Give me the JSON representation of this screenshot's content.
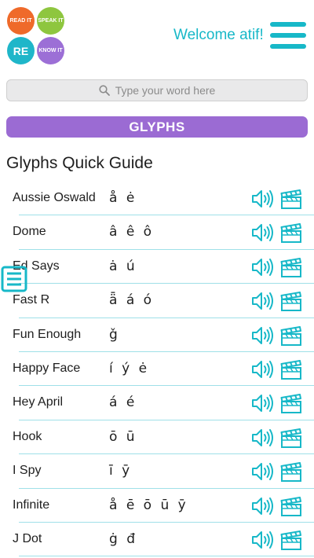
{
  "header": {
    "logo": {
      "read": "READ IT",
      "speak": "SPEAK IT",
      "re": "RE",
      "know": "KNOW IT"
    },
    "welcome": "Welcome atif!"
  },
  "search": {
    "placeholder": "Type your word here"
  },
  "banner": {
    "label": "GLYPHS"
  },
  "section_title": "Glyphs Quick Guide",
  "rows": [
    {
      "name": "Aussie Oswald",
      "glyphs": "å ė"
    },
    {
      "name": "Dome",
      "glyphs": "â ê ô"
    },
    {
      "name": "Ed Says",
      "glyphs": "ȧ ú"
    },
    {
      "name": "Fast R",
      "glyphs": "ǟ á ó"
    },
    {
      "name": "Fun Enough",
      "glyphs": "ǧ"
    },
    {
      "name": "Happy Face",
      "glyphs": "í ý ė"
    },
    {
      "name": "Hey April",
      "glyphs": "á é"
    },
    {
      "name": "Hook",
      "glyphs": "ō ū"
    },
    {
      "name": "I Spy",
      "glyphs": "ī ȳ"
    },
    {
      "name": "Infinite",
      "glyphs": "å ē ō ū ȳ"
    },
    {
      "name": "J Dot",
      "glyphs": "ġ đ"
    }
  ],
  "colors": {
    "teal": "#17b8c8",
    "purple": "#9b6bd3",
    "orange": "#ef6a2a",
    "green": "#8ec63f"
  },
  "icons": {
    "audio": "speaker-icon",
    "video": "clapperboard-icon",
    "menu": "hamburger-icon",
    "search": "search-icon"
  }
}
